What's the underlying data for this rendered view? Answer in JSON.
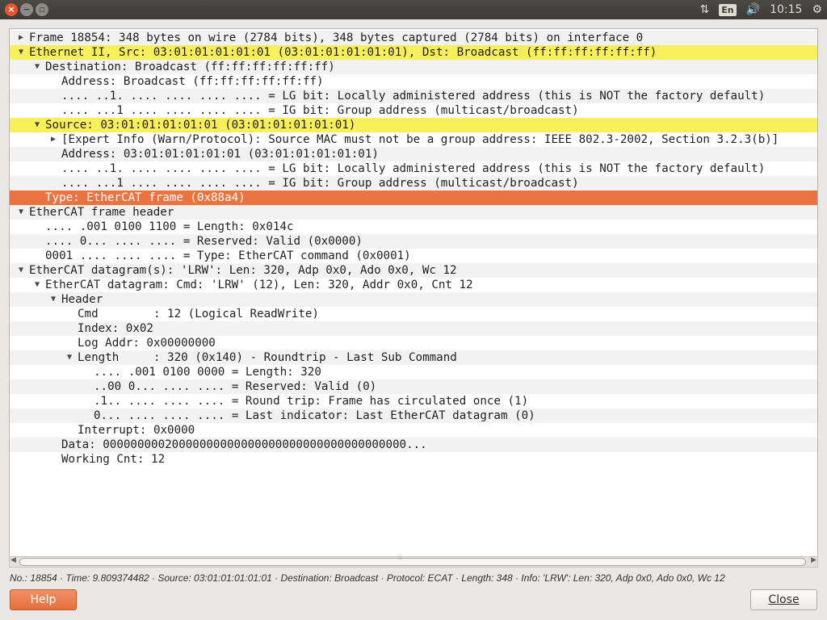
{
  "topbar": {
    "window_buttons": [
      {
        "name": "close-window-icon",
        "glyph": "×"
      },
      {
        "name": "minimize-window-icon",
        "glyph": "−"
      },
      {
        "name": "maximize-window-icon",
        "glyph": "▫"
      }
    ],
    "network_icon": "⇅",
    "language": "En",
    "volume_icon": "🔊",
    "time": "10:15",
    "settings_icon": "⚙"
  },
  "tree": [
    {
      "indent": 0,
      "expander": "collapsed",
      "text": "Frame 18854: 348 bytes on wire (2784 bits), 348 bytes captured (2784 bits) on interface 0",
      "style": "normal"
    },
    {
      "indent": 0,
      "expander": "expanded",
      "text": "Ethernet II, Src: 03:01:01:01:01:01 (03:01:01:01:01:01), Dst: Broadcast (ff:ff:ff:ff:ff:ff)",
      "style": "yellow"
    },
    {
      "indent": 1,
      "expander": "expanded",
      "text": "Destination: Broadcast (ff:ff:ff:ff:ff:ff)",
      "style": "normal"
    },
    {
      "indent": 2,
      "expander": "none",
      "text": "Address: Broadcast (ff:ff:ff:ff:ff:ff)",
      "style": "normal"
    },
    {
      "indent": 2,
      "expander": "none",
      "text": ".... ..1. .... .... .... .... = LG bit: Locally administered address (this is NOT the factory default)",
      "style": "normal"
    },
    {
      "indent": 2,
      "expander": "none",
      "text": ".... ...1 .... .... .... .... = IG bit: Group address (multicast/broadcast)",
      "style": "normal"
    },
    {
      "indent": 1,
      "expander": "expanded",
      "text": "Source: 03:01:01:01:01:01 (03:01:01:01:01:01)",
      "style": "yellow"
    },
    {
      "indent": 2,
      "expander": "collapsed",
      "text": "[Expert Info (Warn/Protocol): Source MAC must not be a group address: IEEE 802.3-2002, Section 3.2.3(b)]",
      "style": "normal"
    },
    {
      "indent": 2,
      "expander": "none",
      "text": "Address: 03:01:01:01:01:01 (03:01:01:01:01:01)",
      "style": "normal"
    },
    {
      "indent": 2,
      "expander": "none",
      "text": ".... ..1. .... .... .... .... = LG bit: Locally administered address (this is NOT the factory default)",
      "style": "normal"
    },
    {
      "indent": 2,
      "expander": "none",
      "text": ".... ...1 .... .... .... .... = IG bit: Group address (multicast/broadcast)",
      "style": "normal"
    },
    {
      "indent": 1,
      "expander": "none",
      "text": "Type: EtherCAT frame (0x88a4)",
      "style": "orange"
    },
    {
      "indent": 0,
      "expander": "expanded",
      "text": "EtherCAT frame header",
      "style": "normal"
    },
    {
      "indent": 1,
      "expander": "none",
      "text": ".... .001 0100 1100 = Length: 0x014c",
      "style": "normal"
    },
    {
      "indent": 1,
      "expander": "none",
      "text": ".... 0... .... .... = Reserved: Valid (0x0000)",
      "style": "normal"
    },
    {
      "indent": 1,
      "expander": "none",
      "text": "0001 .... .... .... = Type: EtherCAT command (0x0001)",
      "style": "normal"
    },
    {
      "indent": 0,
      "expander": "expanded",
      "text": "EtherCAT datagram(s): 'LRW': Len: 320, Adp 0x0, Ado 0x0, Wc 12",
      "style": "normal"
    },
    {
      "indent": 1,
      "expander": "expanded",
      "text": "EtherCAT datagram: Cmd: 'LRW' (12), Len: 320, Addr 0x0, Cnt 12",
      "style": "normal"
    },
    {
      "indent": 2,
      "expander": "expanded",
      "text": "Header",
      "style": "normal"
    },
    {
      "indent": 3,
      "expander": "none",
      "text": "Cmd        : 12 (Logical ReadWrite)",
      "style": "normal"
    },
    {
      "indent": 3,
      "expander": "none",
      "text": "Index: 0x02",
      "style": "normal"
    },
    {
      "indent": 3,
      "expander": "none",
      "text": "Log Addr: 0x00000000",
      "style": "normal"
    },
    {
      "indent": 3,
      "expander": "expanded",
      "text": "Length     : 320 (0x140) - Roundtrip - Last Sub Command",
      "style": "normal"
    },
    {
      "indent": 4,
      "expander": "none",
      "text": ".... .001 0100 0000 = Length: 320",
      "style": "normal"
    },
    {
      "indent": 4,
      "expander": "none",
      "text": "..00 0... .... .... = Reserved: Valid (0)",
      "style": "normal"
    },
    {
      "indent": 4,
      "expander": "none",
      "text": ".1.. .... .... .... = Round trip: Frame has circulated once (1)",
      "style": "normal"
    },
    {
      "indent": 4,
      "expander": "none",
      "text": "0... .... .... .... = Last indicator: Last EtherCAT datagram (0)",
      "style": "normal"
    },
    {
      "indent": 3,
      "expander": "none",
      "text": "Interrupt: 0x0000",
      "style": "normal"
    },
    {
      "indent": 2,
      "expander": "none",
      "text": "Data: 00000000020000000000000000000000000000000000...",
      "style": "normal"
    },
    {
      "indent": 2,
      "expander": "none",
      "text": "Working Cnt: 12",
      "style": "normal"
    }
  ],
  "scrollbar": {
    "grip": "⦙⦙⦙"
  },
  "status_line": "No.: 18854 · Time: 9.809374482 · Source: 03:01:01:01:01:01 · Destination: Broadcast · Protocol: ECAT · Length: 348 · Info: 'LRW': Len: 320, Adp 0x0, Ado 0x0, Wc 12",
  "buttons": {
    "help": "Help",
    "close": "Close"
  },
  "colors": {
    "highlight_yellow": "#f8f05a",
    "highlight_orange": "#ea7340",
    "help_button": "#e66f3b"
  }
}
